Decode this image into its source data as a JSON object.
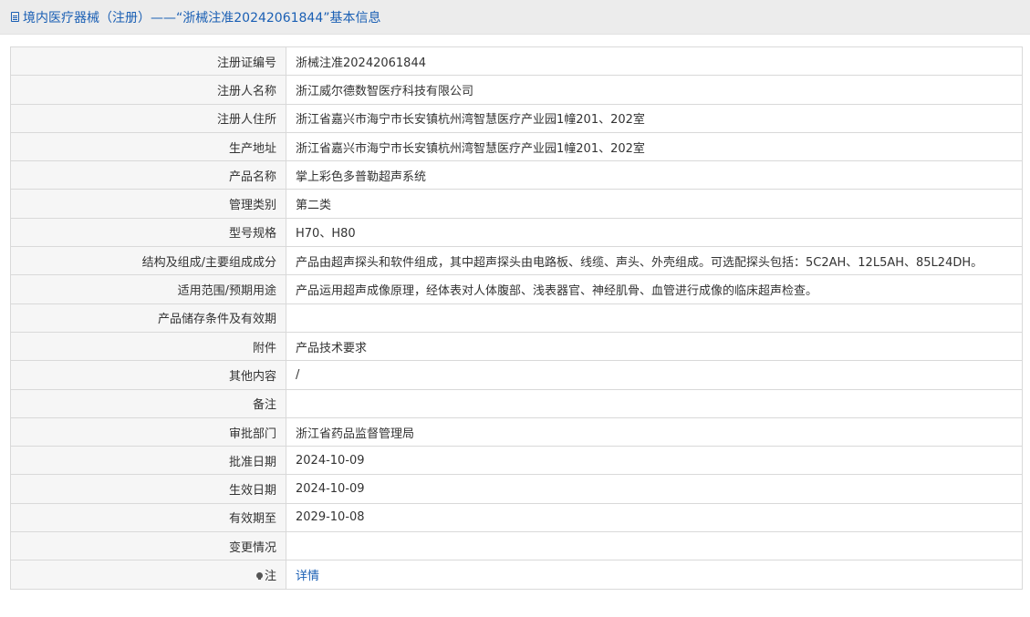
{
  "header": {
    "icon": "document-icon",
    "title": "境内医疗器械（注册）——“浙械注准20242061844”基本信息",
    "color": "#1a5fb4"
  },
  "rows": [
    {
      "name": "registration-number",
      "label": "注册证编号",
      "value": "浙械注准20242061844"
    },
    {
      "name": "registrant-name",
      "label": "注册人名称",
      "value": "浙江威尔德数智医疗科技有限公司"
    },
    {
      "name": "registrant-address",
      "label": "注册人住所",
      "value": "浙江省嘉兴市海宁市长安镇杭州湾智慧医疗产业园1幢201、202室"
    },
    {
      "name": "production-address",
      "label": "生产地址",
      "value": "浙江省嘉兴市海宁市长安镇杭州湾智慧医疗产业园1幢201、202室"
    },
    {
      "name": "product-name",
      "label": "产品名称",
      "value": "掌上彩色多普勒超声系统"
    },
    {
      "name": "management-category",
      "label": "管理类别",
      "value": "第二类"
    },
    {
      "name": "model-spec",
      "label": "型号规格",
      "value": "H70、H80"
    },
    {
      "name": "structure-composition",
      "label": "结构及组成/主要组成成分",
      "value": "产品由超声探头和软件组成，其中超声探头由电路板、线缆、声头、外壳组成。可选配探头包括：5C2AH、12L5AH、85L24DH。"
    },
    {
      "name": "scope-of-use",
      "label": "适用范围/预期用途",
      "value": "产品运用超声成像原理，经体表对人体腹部、浅表器官、神经肌骨、血管进行成像的临床超声检查。"
    },
    {
      "name": "storage-conditions",
      "label": "产品储存条件及有效期",
      "value": ""
    },
    {
      "name": "attachment",
      "label": "附件",
      "value": "产品技术要求"
    },
    {
      "name": "other-content",
      "label": "其他内容",
      "value": "/"
    },
    {
      "name": "remarks",
      "label": "备注",
      "value": ""
    },
    {
      "name": "approval-department",
      "label": "审批部门",
      "value": "浙江省药品监督管理局"
    },
    {
      "name": "approval-date",
      "label": "批准日期",
      "value": "2024-10-09"
    },
    {
      "name": "effective-date",
      "label": "生效日期",
      "value": "2024-10-09"
    },
    {
      "name": "expiry-date",
      "label": "有效期至",
      "value": "2029-10-08"
    },
    {
      "name": "change-status",
      "label": "变更情况",
      "value": ""
    }
  ],
  "note": {
    "icon": "lightbulb-icon",
    "label": "注",
    "link_text": "详情",
    "link_color": "#1a5fb4"
  }
}
